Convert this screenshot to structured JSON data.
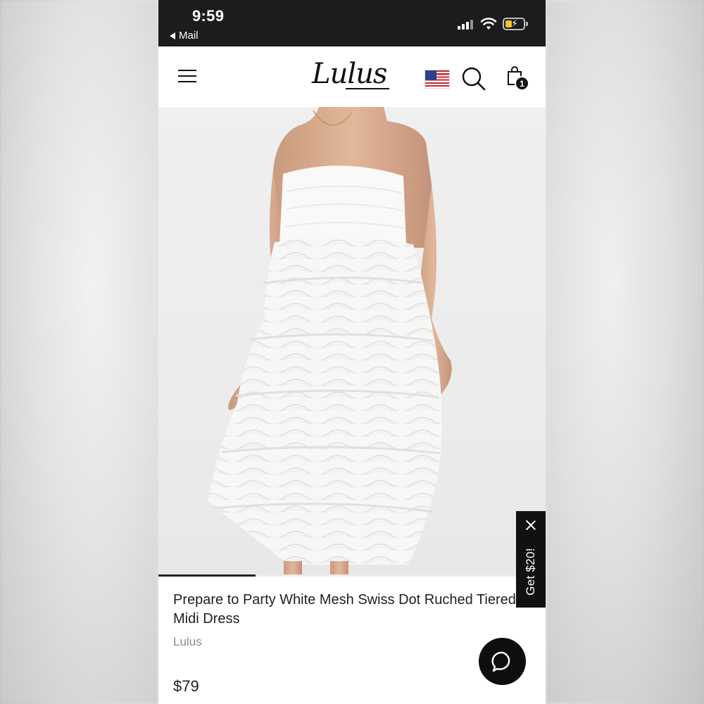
{
  "status_bar": {
    "time": "9:59",
    "back_label": "Mail",
    "icons": [
      "cellular-signal-icon",
      "wifi-icon",
      "battery-charging-icon"
    ],
    "battery_color": "#f2c230"
  },
  "header": {
    "logo_text": "Lulus",
    "menu_icon": "hamburger-menu-icon",
    "flag_icon": "us-flag-icon",
    "search_icon": "search-icon",
    "bag_icon": "shopping-bag-icon",
    "bag_count": "1"
  },
  "gallery": {
    "image_description_icon": "product-photo",
    "progress": 0.25
  },
  "product": {
    "title": "Prepare to Party White Mesh Swiss Dot Ruched Tiered Midi Dress",
    "brand": "Lulus",
    "price": "$79"
  },
  "promo": {
    "label": "Get $20!",
    "close_icon": "close-icon"
  },
  "chat": {
    "icon": "chat-bubble-icon"
  },
  "colors": {
    "status_bar_bg": "#1c1c1e",
    "text_primary": "#1f1f1f",
    "text_secondary": "#8a8a8a",
    "accent_dark": "#111111"
  }
}
